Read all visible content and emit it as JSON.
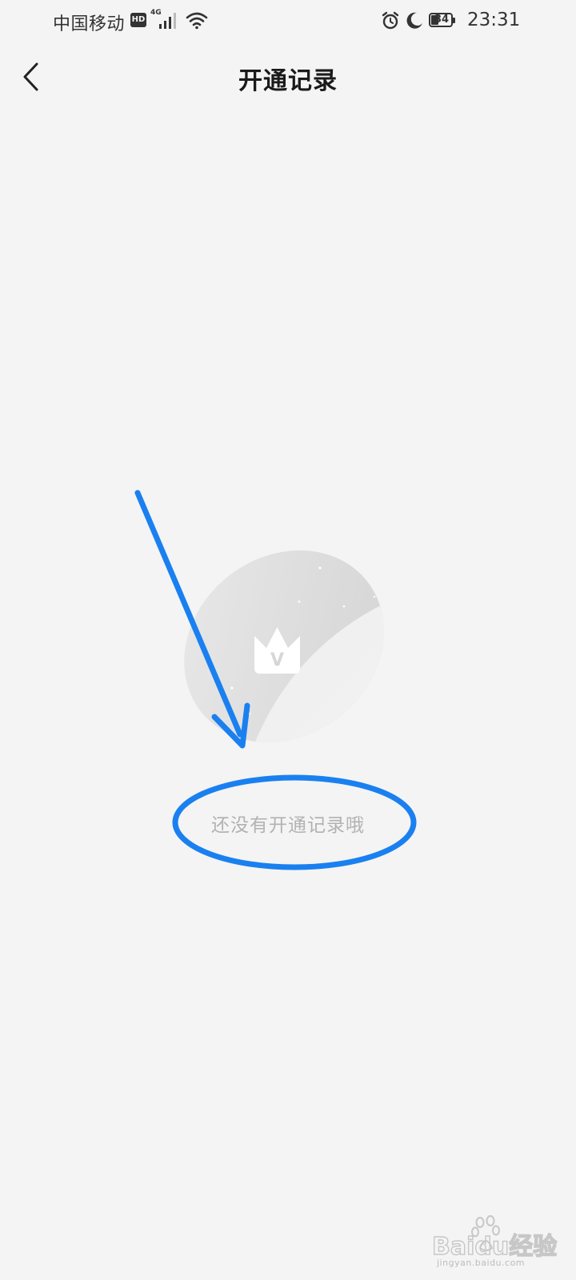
{
  "status_bar": {
    "carrier": "中国移动",
    "hd_badge": "HD",
    "network_type": "4G",
    "battery_level": "34",
    "time": "23:31"
  },
  "header": {
    "title": "开通记录"
  },
  "empty_state": {
    "message": "还没有开通记录哦",
    "illustration_letter": "V"
  },
  "annotation": {
    "color": "#1a80f0"
  },
  "watermark": {
    "text": "jingyan.baidu.com",
    "logo_text": "Baidu经验"
  },
  "icons": {
    "back": "chevron-left-icon",
    "signal": "signal-icon",
    "wifi": "wifi-icon",
    "alarm": "alarm-icon",
    "moon": "moon-icon",
    "battery": "battery-icon"
  }
}
